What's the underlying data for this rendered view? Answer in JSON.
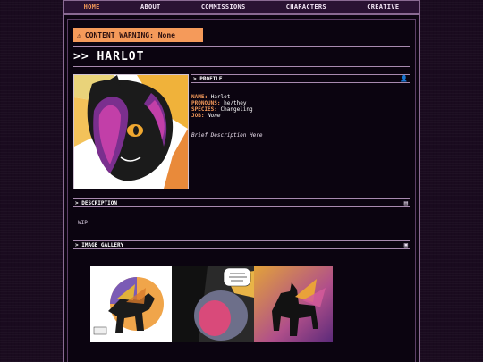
{
  "nav": {
    "items": [
      "HOME",
      "ABOUT",
      "COMMISSIONS",
      "CHARACTERS",
      "CREATIVE"
    ],
    "active": "HOME"
  },
  "content_warning": {
    "label": "CONTENT WARNING: None",
    "icon": "warning-icon"
  },
  "title": ">> HARLOT",
  "profile": {
    "heading": "PROFILE",
    "icon": "person-icon",
    "fields": {
      "name_key": "NAME:",
      "name_val": "Harlot",
      "pronouns_key": "PRONOUNS:",
      "pronouns_val": "he/they",
      "species_key": "SPECIES:",
      "species_val": "Changeling",
      "job_key": "JOB:",
      "job_val": "None"
    },
    "brief": "Brief Description Here"
  },
  "description": {
    "heading": "DESCRIPTION",
    "icon": "document-icon",
    "text": "WIP"
  },
  "gallery": {
    "heading": "IMAGE GALLERY",
    "icon": "camera-icon"
  },
  "colors": {
    "accent": "#f59a5a",
    "bg": "#0b0410",
    "border": "#a88aaf"
  }
}
